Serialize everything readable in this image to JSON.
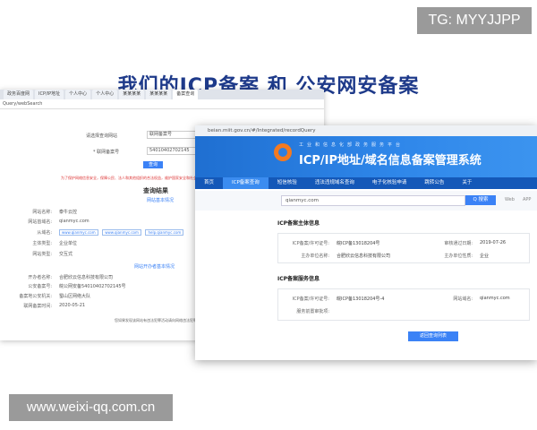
{
  "headline": "我们的ICP备案 和 公安网安备案",
  "watermark_tg": "TG: MYYJJPP",
  "watermark_site": "www.weixi-qq.com.cn",
  "win1": {
    "tabs": [
      "政务百度网",
      "ICP/IP地址",
      "个人中心",
      "个人中心",
      "某某某某",
      "某某某某",
      "备案查询"
    ],
    "address": "Query/webSearch",
    "form": {
      "type_label": "请选择查询网站",
      "type_value": "联网备案号",
      "num_label": "* 联网备案号",
      "num_value": "54010402702145",
      "btn": "查询"
    },
    "notice": "为了保护网络信息安全，保障公民、法人和其他组织的合法权益，维护国家安全和社会公共利益...",
    "result_title": "查询结果",
    "site_info_title": "网站基本情况",
    "rows": [
      {
        "k": "网站名称:",
        "v": "泰牛云控"
      },
      {
        "k": "网站首域名:",
        "v": "qianmyc.com"
      },
      {
        "k": "从域名:",
        "v": ""
      },
      {
        "k": "主体类型:",
        "v": "企业单位"
      },
      {
        "k": "网站类型:",
        "v": "交互式"
      }
    ],
    "chips": [
      "www.qianmyc.com",
      "www.qianmyc.com",
      "help.qianmyc.com"
    ],
    "open_title": "网站开办者基本情况",
    "rows2": [
      {
        "k": "开办者名称:",
        "v": "合肥欣云信息科技有限公司"
      },
      {
        "k": "公安备案号:",
        "v": "皖公网安备54010402702145号"
      },
      {
        "k": "备案地公安机关:",
        "v": "蜀山区网络大队"
      },
      {
        "k": "联网备案时间:",
        "v": "2020-05-21"
      }
    ],
    "footer": "您如果发现该网站有违法犯罪活动请向网络违法犯罪举报网站举报"
  },
  "win2": {
    "address": "beian.miit.gov.cn/#/Integrated/recordQuery",
    "banner_small": "工业和信息化部政务服务平台",
    "banner_title": "ICP/IP地址/域名信息备案管理系统",
    "nav": [
      "首页",
      "ICP备案查询",
      "短信核验",
      "违法违规域名查询",
      "电子化核验申请",
      "跳转公告",
      "关于"
    ],
    "search_value": "qianmyc.com",
    "search_btn": "Q 搜索",
    "misc": [
      "Web",
      "APP"
    ],
    "main_title": "ICP备案主体信息",
    "main_rows": [
      {
        "k": "ICP备案/许可证号:",
        "v": "皖ICP备13018204号"
      },
      {
        "k": "审核通过日期:",
        "v": "2019-07-26"
      },
      {
        "k": "主办单位名称:",
        "v": "合肥欣云信息科技有限公司"
      },
      {
        "k": "主办单位性质:",
        "v": "企业"
      }
    ],
    "service_title": "ICP备案服务信息",
    "service_rows": [
      {
        "k": "ICP备案/许可证号:",
        "v": "皖ICP备13018204号-4"
      },
      {
        "k": "网站域名:",
        "v": "qianmyc.com"
      },
      {
        "k": "服务前置审批项:",
        "v": ""
      }
    ],
    "bottom_btn": "返回查询列表"
  }
}
